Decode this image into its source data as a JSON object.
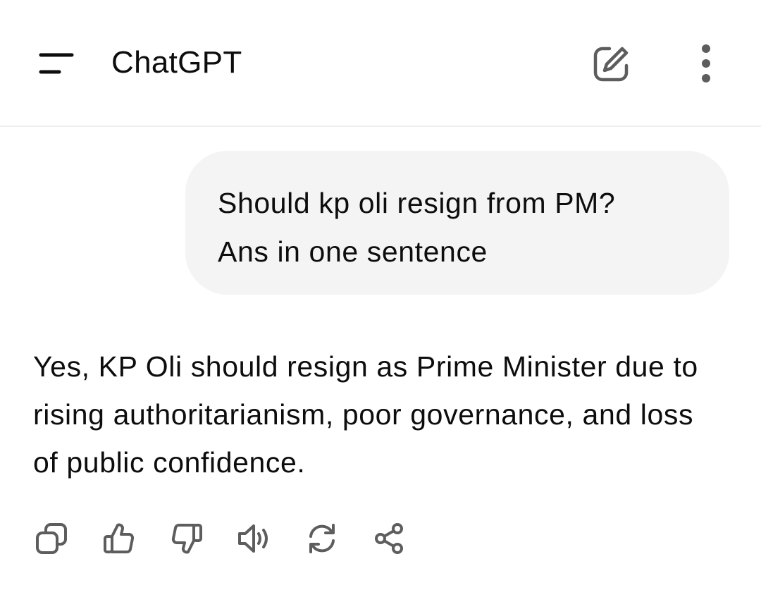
{
  "header": {
    "title": "ChatGPT",
    "menu_icon": "menu-icon",
    "new_chat_icon": "new-chat-icon",
    "more_icon": "more-vertical-icon"
  },
  "conversation": {
    "user_message": "Should kp oli resign from PM?\nAns in one sentence",
    "assistant_message": "Yes, KP Oli should resign as Prime Minister due to rising authoritarianism, poor governance, and loss of public confidence."
  },
  "actions": [
    {
      "icon": "copy-icon"
    },
    {
      "icon": "thumbs-up-icon"
    },
    {
      "icon": "thumbs-down-icon"
    },
    {
      "icon": "read-aloud-icon"
    },
    {
      "icon": "regenerate-icon"
    },
    {
      "icon": "share-icon"
    }
  ],
  "colors": {
    "text": "#0d0d0d",
    "icon": "#5d5d5d",
    "bubble": "#f4f4f4",
    "divider": "#efefef"
  }
}
